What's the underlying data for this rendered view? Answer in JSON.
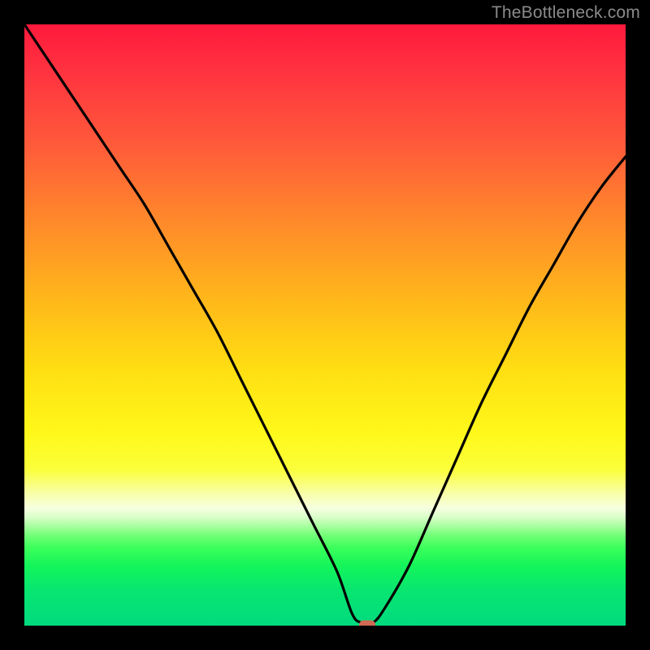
{
  "watermark": {
    "text": "TheBottleneck.com"
  },
  "chart_data": {
    "type": "line",
    "title": "",
    "xlabel": "",
    "ylabel": "",
    "xlim": [
      0,
      100
    ],
    "ylim": [
      0,
      100
    ],
    "grid": false,
    "series": [
      {
        "name": "bottleneck-curve",
        "x": [
          0,
          4,
          8,
          12,
          16,
          20,
          24,
          28,
          32,
          36,
          40,
          44,
          48,
          52,
          54.5,
          56,
          58,
          60,
          64,
          68,
          72,
          76,
          80,
          84,
          88,
          92,
          96,
          100
        ],
        "values": [
          100,
          94,
          88,
          82,
          76,
          70,
          63,
          56,
          49,
          41,
          33,
          25,
          17,
          9,
          2,
          0.5,
          0.5,
          3,
          10,
          19,
          28,
          37,
          45,
          53,
          60,
          67,
          73,
          78
        ]
      }
    ],
    "marker": {
      "x": 57,
      "y": 0.2,
      "color": "#cf6a55"
    },
    "background_gradient": {
      "top": "#ff1a3c",
      "mid": "#ffe012",
      "bottom": "#02da7f"
    }
  }
}
